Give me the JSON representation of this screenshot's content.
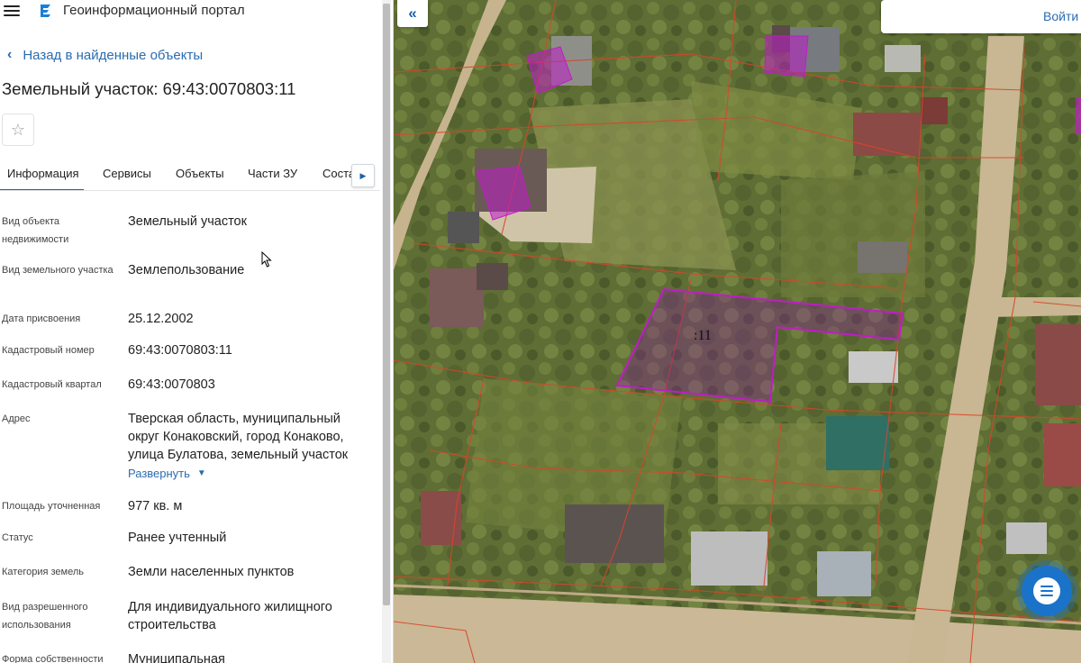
{
  "app": {
    "title": "Геоинформационный портал",
    "colors": {
      "accent": "#1c5fa8",
      "link": "#2b6cb0",
      "parcel_outline": "#c01cc8",
      "cadastral_lines": "#d9452a"
    }
  },
  "header": {
    "back_label": "Назад в найденные объекты",
    "object_title": "Земельный участок: 69:43:0070803:11",
    "favorite_icon": "star-icon"
  },
  "tabs": [
    {
      "label": "Информация",
      "active": true
    },
    {
      "label": "Сервисы",
      "active": false
    },
    {
      "label": "Объекты",
      "active": false
    },
    {
      "label": "Части ЗУ",
      "active": false
    },
    {
      "label": "Соста",
      "active": false
    }
  ],
  "details": [
    {
      "label": "Вид объекта недвижимости",
      "value": "Земельный участок"
    },
    {
      "label": "Вид земельного участка",
      "value": "Землепользование"
    },
    {
      "label": "Дата присвоения",
      "value": "25.12.2002"
    },
    {
      "label": "Кадастровый номер",
      "value": "69:43:0070803:11"
    },
    {
      "label": "Кадастровый квартал",
      "value": "69:43:0070803"
    },
    {
      "label": "Адрес",
      "value": "Тверская область, муниципальный округ Конаковский, город Конаково, улица Булатова, земельный участок",
      "expand": "Развернуть"
    },
    {
      "label": "Площадь уточненная",
      "value": "977 кв. м"
    },
    {
      "label": "Статус",
      "value": "Ранее учтенный"
    },
    {
      "label": "Категория земель",
      "value": "Земли населенных пунктов"
    },
    {
      "label": "Вид разрешенного использования",
      "value": "Для индивидуального жилищного строительства"
    },
    {
      "label": "Форма собственности",
      "value": "Муниципальная"
    }
  ],
  "map": {
    "parcel_label": ":11",
    "login_label": "Войти",
    "collapse_icon": "double-chevron-left-icon",
    "chat_icon": "chat-icon"
  }
}
